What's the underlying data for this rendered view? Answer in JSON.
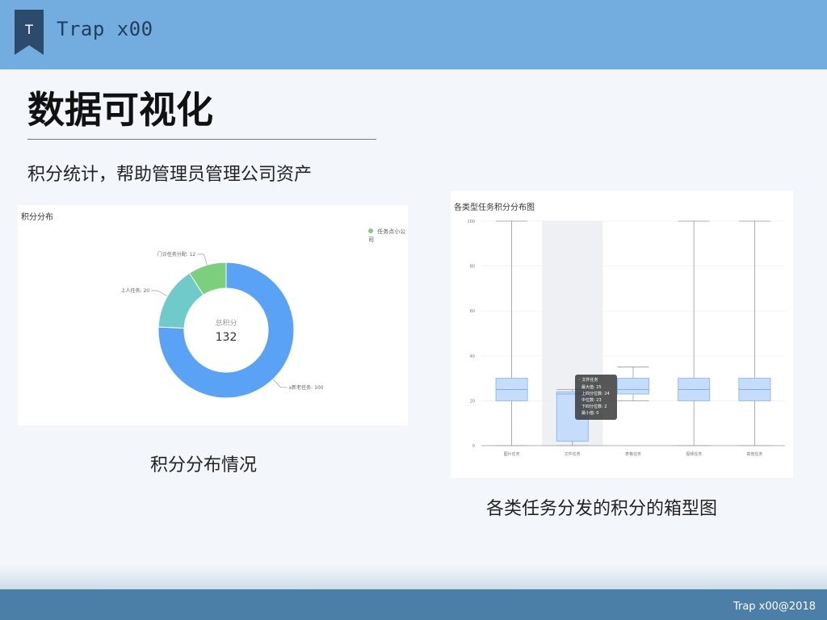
{
  "brand": {
    "name": "Trap x00",
    "logo_letter": "T"
  },
  "page": {
    "title": "数据可视化",
    "subtitle": "积分统计，帮助管理员管理公司资产"
  },
  "donut_panel": {
    "title": "积分分布",
    "legend_label": "任务点小公司",
    "center_label": "总积分",
    "center_value": "132",
    "caption": "积分分布情况",
    "colors": [
      "#5aa2f5",
      "#6fcac9",
      "#7ccf7c"
    ]
  },
  "box_panel": {
    "title": "各类型任务积分分布图",
    "caption": "各类任务分发的积分的箱型图",
    "tooltip": {
      "title": "文件任务",
      "lines": [
        "最大值: 25",
        "上四分位数: 24",
        "中位数: 23",
        "下四分位数: 2",
        "最小值: 0"
      ]
    },
    "y_ticks": [
      "100",
      "80",
      "60",
      "40",
      "20",
      "0"
    ],
    "colors": {
      "box_fill": "#c6dcfb",
      "box_stroke": "#7fb0ee"
    }
  },
  "chart_data": [
    {
      "type": "pie",
      "title": "积分分布",
      "center_label": "总积分",
      "center_value": 132,
      "slices": [
        {
          "label": "x新老任务: 100",
          "value": 100
        },
        {
          "label": "上人任务: 20",
          "value": 20
        },
        {
          "label": "门诊任务分配: 12",
          "value": 12
        }
      ]
    },
    {
      "type": "box",
      "title": "各类型任务积分分布图",
      "ylim": [
        0,
        100
      ],
      "categories": [
        "图片任务",
        "文件任务",
        "表格任务",
        "视频任务",
        "其他任务"
      ],
      "boxes": [
        {
          "min": 0,
          "q1": 20,
          "median": 25,
          "q3": 30,
          "max": 100
        },
        {
          "min": 0,
          "q1": 2,
          "median": 23,
          "q3": 24,
          "max": 25
        },
        {
          "min": 20,
          "q1": 23,
          "median": 25,
          "q3": 30,
          "max": 35
        },
        {
          "min": 0,
          "q1": 20,
          "median": 25,
          "q3": 30,
          "max": 100
        },
        {
          "min": 0,
          "q1": 20,
          "median": 25,
          "q3": 30,
          "max": 100
        }
      ],
      "highlighted_category": "文件任务"
    }
  ],
  "footer": {
    "copyright": "Trap x00@2018"
  }
}
